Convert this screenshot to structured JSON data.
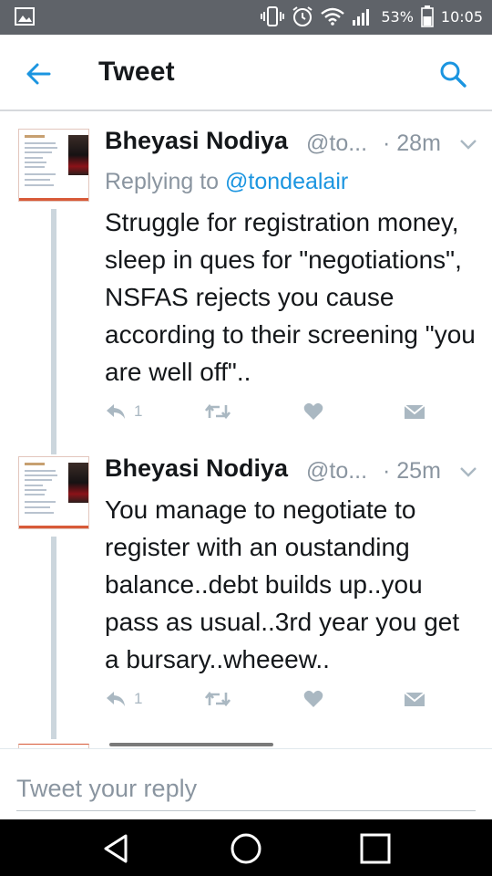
{
  "status_bar": {
    "battery": "53%",
    "time": "10:05",
    "icons": [
      "gallery-icon",
      "vibrate-icon",
      "alarm-icon",
      "wifi-icon",
      "signal-icon",
      "battery-icon"
    ]
  },
  "header": {
    "title": "Tweet",
    "back_icon": "arrow-left-icon",
    "search_icon": "search-icon"
  },
  "tweets": [
    {
      "name": "Bheyasi Nodiya",
      "handle": "@to...",
      "time": "· 28m",
      "reply_prefix": "Replying to ",
      "reply_mention": "@tondealair",
      "text": "Struggle for registration money, sleep in ques for \"negotiations\", NSFAS rejects you cause according to their screening \"you are well off\"..",
      "reply_count": "1"
    },
    {
      "name": "Bheyasi Nodiya",
      "handle": "@to...",
      "time": "· 25m",
      "text": "You manage to negotiate to register with an oustanding balance..debt builds up..you pass as usual..3rd year you get a bursary..wheeew..",
      "reply_count": "1"
    }
  ],
  "reply_bar": {
    "placeholder": "Tweet your reply"
  },
  "colors": {
    "accent": "#1b95e0",
    "status_bar": "#5f6369",
    "muted": "#8a95a0",
    "action_icons": "#aab8c2"
  }
}
